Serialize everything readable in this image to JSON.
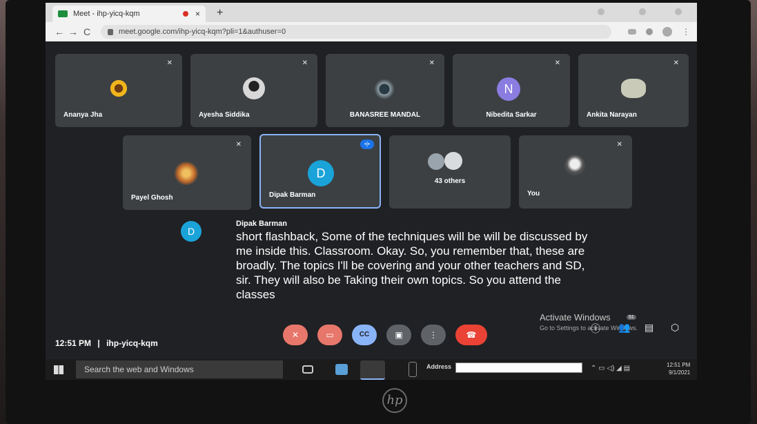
{
  "browser": {
    "tab_title": "Meet - ihp-yicq-kqm",
    "tab_close": "×",
    "new_tab": "+",
    "url": "meet.google.com/ihp-yicq-kqm?pli=1&authuser=0",
    "back": "←",
    "forward": "→",
    "reload": "C"
  },
  "participants_row1": [
    {
      "name": "Ananya Jha",
      "avatar": "sunflower",
      "color": "#f1b51c"
    },
    {
      "name": "Ayesha Siddika",
      "avatar": "photo",
      "color": "#d8d8d8"
    },
    {
      "name": "BANASREE MANDAL",
      "avatar": "photo",
      "color": "#8ea0a8"
    },
    {
      "name": "Nibedita Sarkar",
      "avatar": "N",
      "color": "#8a7ce0"
    },
    {
      "name": "Ankita Narayan",
      "avatar": "photo",
      "color": "#c9cbb8"
    }
  ],
  "participants_row2": [
    {
      "name": "Payel Ghosh",
      "avatar": "photo",
      "color": "#c0692a"
    },
    {
      "name": "Dipak Barman",
      "avatar": "D",
      "color": "#1aa3d9"
    },
    {
      "name": "43 others",
      "avatar": "group",
      "color": "#9aa4ac"
    },
    {
      "name": "You",
      "avatar": "photo",
      "color": "#b8bcc0"
    }
  ],
  "caption": {
    "avatar_letter": "D",
    "speaker": "Dipak Barman",
    "text": "short flashback, Some of the techniques will be will be discussed by me inside this. Classroom. Okay. So, you remember that, these are broadly. The topics I'll be covering and your other teachers and SD, sir. They will also be Taking their own topics. So you attend the classes"
  },
  "meeting": {
    "time": "12:51 PM",
    "separator": "|",
    "code": "ihp-yicq-kqm"
  },
  "controls": {
    "mic_icon": "mic-off-icon",
    "cam_icon": "camera-off-icon",
    "cc_label": "CC",
    "present_icon": "present-icon",
    "more_label": "⋮",
    "leave_icon": "hang-up-icon"
  },
  "watermark": {
    "title": "Activate Windows",
    "subtitle": "Go to Settings to activate Windows.",
    "badge": "51"
  },
  "taskbar": {
    "search_placeholder": "Search the web and Windows",
    "address_label": "Address",
    "time": "12:51 PM",
    "date": "9/1/2021"
  },
  "colors": {
    "tile_bg": "#3c4043",
    "meet_bg": "#202124",
    "mic_btn": "#e8776b",
    "cc_btn": "#8ab4f8",
    "active_outline": "#8ab4f8"
  }
}
